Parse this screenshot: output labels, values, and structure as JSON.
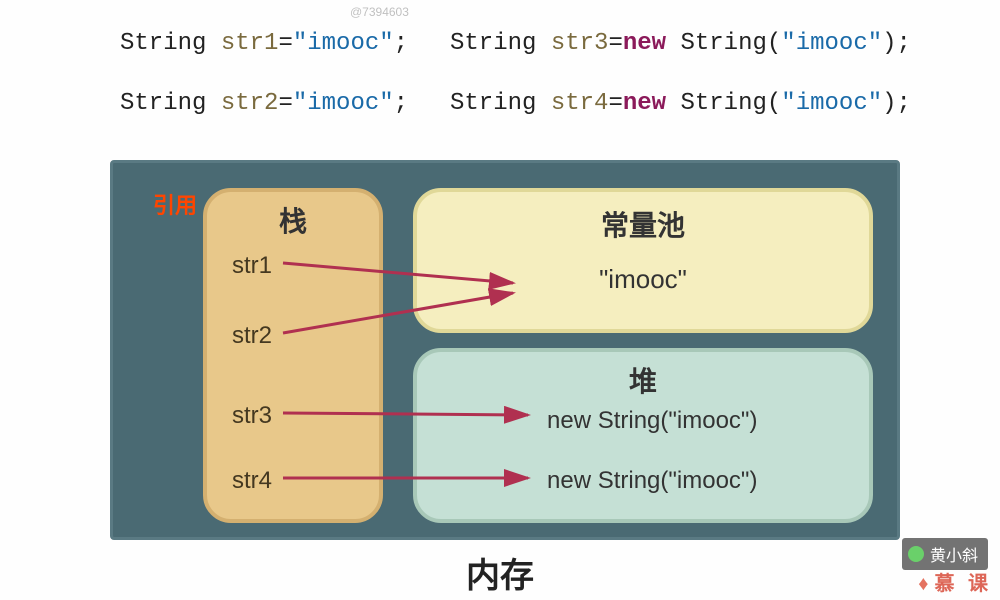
{
  "watermark": "@7394603",
  "code": {
    "type_kw": "String",
    "new_kw": "new",
    "str_literal": "imooc",
    "v1": "str1",
    "v2": "str2",
    "v3": "str3",
    "v4": "str4",
    "ctor": "String"
  },
  "diagram": {
    "reference_label": "引用",
    "stack": {
      "title": "栈",
      "items": [
        "str1",
        "str2",
        "str3",
        "str4"
      ]
    },
    "constant_pool": {
      "title": "常量池",
      "value": "\"imooc\""
    },
    "heap": {
      "title": "堆",
      "items": [
        "new String(\"imooc\")",
        "new String(\"imooc\")"
      ]
    },
    "caption": "内存"
  },
  "credits": {
    "author": "黄小斜",
    "site": "慕 课"
  }
}
